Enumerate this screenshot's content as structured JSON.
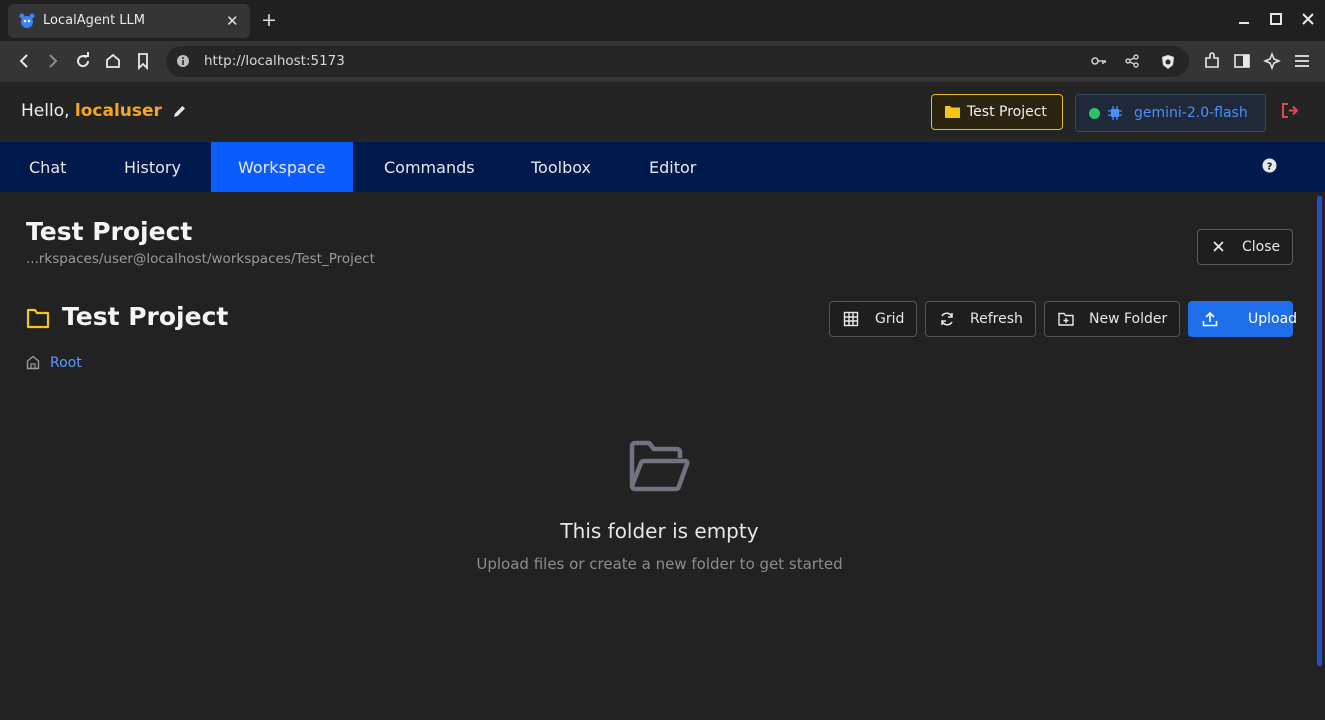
{
  "browser": {
    "tab_title": "LocalAgent LLM",
    "url": "http://localhost:5173"
  },
  "header": {
    "greeting": "Hello,",
    "username": "localuser",
    "project_label": "Test Project",
    "model_label": "gemini-2.0-flash",
    "model_status_color": "#2fc26b"
  },
  "nav": {
    "tabs": [
      {
        "label": "Chat",
        "active": false
      },
      {
        "label": "History",
        "active": false
      },
      {
        "label": "Workspace",
        "active": true
      },
      {
        "label": "Commands",
        "active": false
      },
      {
        "label": "Toolbox",
        "active": false
      },
      {
        "label": "Editor",
        "active": false
      }
    ]
  },
  "workspace": {
    "title": "Test Project",
    "path": "...rkspaces/user@localhost/workspaces/Test_Project",
    "close_label": "Close",
    "folder_title": "Test Project",
    "toolbar": {
      "grid_label": "Grid",
      "refresh_label": "Refresh",
      "new_folder_label": "New Folder",
      "upload_label": "Upload"
    },
    "breadcrumb_root": "Root",
    "empty_title": "This folder is empty",
    "empty_subtitle": "Upload files or create a new folder to get started"
  },
  "colors": {
    "accent": "#0b5cff",
    "nav_bg": "#001a4d",
    "username": "#f5a623",
    "project_border": "#e8b920",
    "logout": "#e5484d"
  }
}
